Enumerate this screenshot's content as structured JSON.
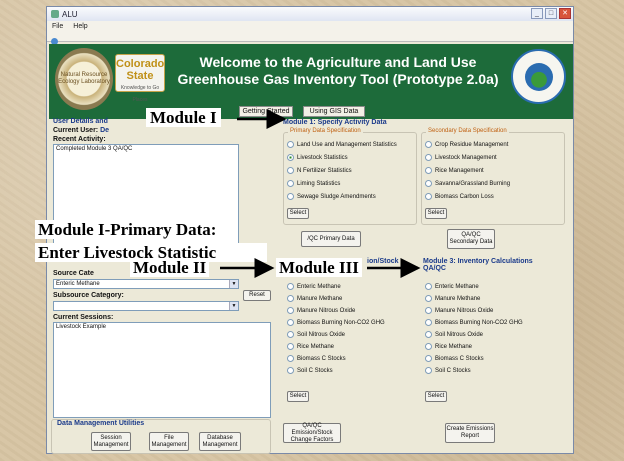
{
  "window": {
    "title": "ALU",
    "menu": [
      "File",
      "Help"
    ]
  },
  "banner": {
    "title_line1": "Welcome to the Agriculture and Land Use",
    "title_line2": "Greenhouse Gas Inventory Tool (Prototype 2.0a)",
    "logo_left": "Natural Resource Ecology Laboratory",
    "logo_cs_1": "Colorado",
    "logo_cs_2": "State",
    "logo_cs_3": "Knowledge to Go Places",
    "btn_getting_started": "Getting Started",
    "btn_gis": "Using GIS Data"
  },
  "left": {
    "user_details": "User Details and",
    "current_user_label": "Current User:",
    "current_user_val": "De",
    "recent_activity": "Recent Activity:",
    "recent_text": "Completed Module 3 QA/QC",
    "source_label": "Source Cate",
    "source_value": "Enteric Methane",
    "subsource_label": "Subsource Category:",
    "reset": "Reset",
    "current_sessions": "Current Sessions:",
    "session_text": "Livestock Example",
    "dm_title": "Data Management Utilities",
    "dm_buttons": [
      "Session Management",
      "File Management",
      "Database Management"
    ]
  },
  "module1": {
    "title": "Module 1: Specify Activity Data",
    "primary": "Primary Data Specification",
    "primary_items": [
      "Land Use and Management Statistics",
      "Livestock Statistics",
      "N Fertilizer Statistics",
      "Liming Statistics",
      "Sewage Sludge Amendments"
    ],
    "secondary": "Secondary Data Specification",
    "secondary_items": [
      "Crop Residue Management",
      "Livestock Management",
      "Rice Management",
      "Savanna/Grassland Burning",
      "Biomass Carbon Loss"
    ],
    "select": "Select",
    "qaqc_primary": "QA/QC Primary Data",
    "qaqc_primary_partial": "/QC Primary Data",
    "qaqc_secondary": "QA/QC Secondary Data"
  },
  "module2": {
    "title_partial": "ion/Stock",
    "items": [
      "Enteric Methane",
      "Manure Methane",
      "Manure Nitrous Oxide",
      "Biomass Burning Non-CO2 GHG",
      "Soil Nitrous Oxide",
      "Rice Methane",
      "Biomass C Stocks",
      "Soil C Stocks"
    ],
    "select": "Select",
    "qaqc_btn": "QA/QC Emission/Stock Change Factors"
  },
  "module3": {
    "title": "Module 3: Inventory Calculations QA/QC",
    "items": [
      "Enteric Methane",
      "Manure Methane",
      "Manure Nitrous Oxide",
      "Biomass Burning Non-CO2 GHG",
      "Soil Nitrous Oxide",
      "Rice Methane",
      "Biomass C Stocks",
      "Soil C Stocks"
    ],
    "select": "Select",
    "report_btn": "Create Emissions Report"
  },
  "callouts": {
    "module1": "Module I",
    "primary": "Module I-Primary Data:",
    "livestock": "Enter Livestock Statistic",
    "module2": "Module II",
    "module3": "Module III"
  }
}
